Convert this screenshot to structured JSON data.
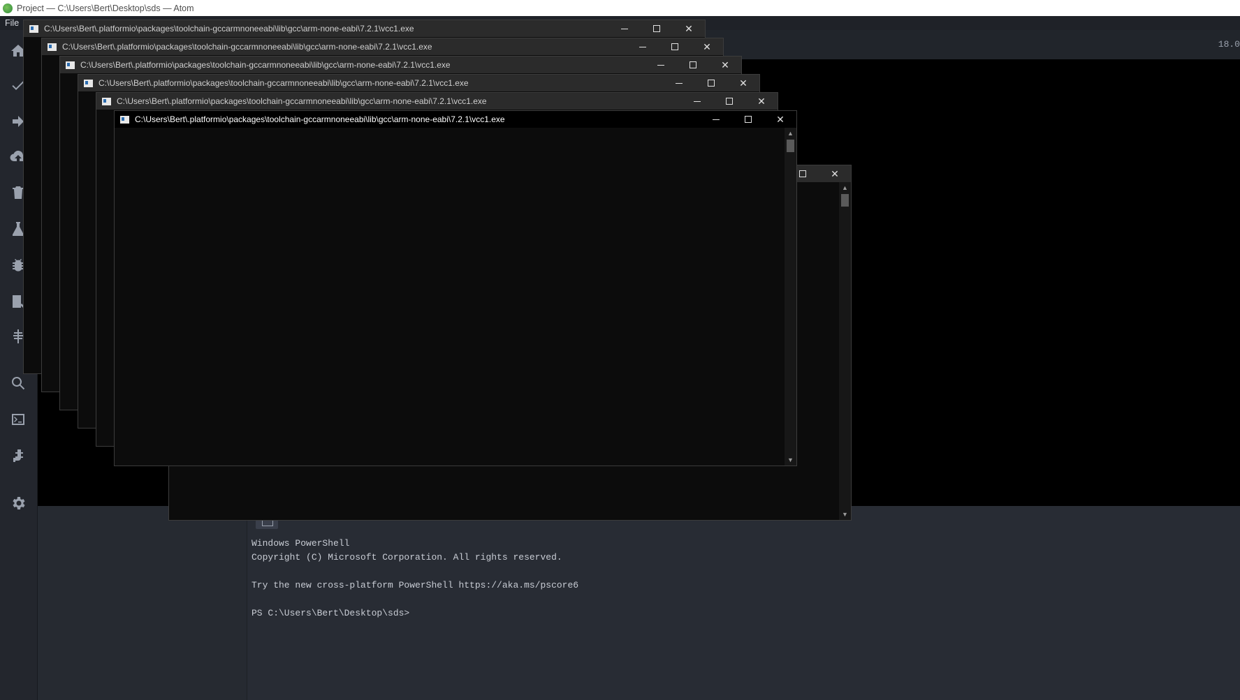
{
  "window": {
    "title": "Project — C:\\Users\\Bert\\Desktop\\sds — Atom"
  },
  "menu": {
    "file_label": "File"
  },
  "dock_icons": [
    "home-icon",
    "check-icon",
    "arrow-right-icon",
    "upload-cloud-icon",
    "trash-icon",
    "flask-icon",
    "bug-icon",
    "library-icon",
    "device-icon",
    "search-icon",
    "terminal-icon",
    "plug-icon",
    "gear-icon"
  ],
  "editor": {
    "version_text": "18.0"
  },
  "cmd_windows": [
    {
      "title": "C:\\Users\\Bert\\.platformio\\packages\\toolchain-gccarmnoneeabi\\lib\\gcc\\arm-none-eabi\\7.2.1\\vcc1.exe"
    },
    {
      "title": "C:\\Users\\Bert\\.platformio\\packages\\toolchain-gccarmnoneeabi\\lib\\gcc\\arm-none-eabi\\7.2.1\\vcc1.exe"
    },
    {
      "title": "C:\\Users\\Bert\\.platformio\\packages\\toolchain-gccarmnoneeabi\\lib\\gcc\\arm-none-eabi\\7.2.1\\vcc1.exe"
    },
    {
      "title": "C:\\Users\\Bert\\.platformio\\packages\\toolchain-gccarmnoneeabi\\lib\\gcc\\arm-none-eabi\\7.2.1\\vcc1.exe"
    },
    {
      "title": "C:\\Users\\Bert\\.platformio\\packages\\toolchain-gccarmnoneeabi\\lib\\gcc\\arm-none-eabi\\7.2.1\\vcc1.exe"
    },
    {
      "title": "C:\\Users\\Bert\\.platformio\\packages\\toolchain-gccarmnoneeabi\\lib\\gcc\\arm-none-eabi\\7.2.1\\vcc1.exe"
    }
  ],
  "terminal": {
    "lines": [
      "Windows PowerShell",
      "Copyright (C) Microsoft Corporation. All rights reserved.",
      "",
      "Try the new cross-platform PowerShell https://aka.ms/pscore6",
      "",
      "PS C:\\Users\\Bert\\Desktop\\sds>"
    ]
  },
  "colors": {
    "atom_bg": "#282c34",
    "dock_bg": "#23262d",
    "cmd_bg": "#0c0c0c",
    "cmd_titlebar_active": "#000000",
    "cmd_titlebar_inactive": "#2b2b2b"
  }
}
